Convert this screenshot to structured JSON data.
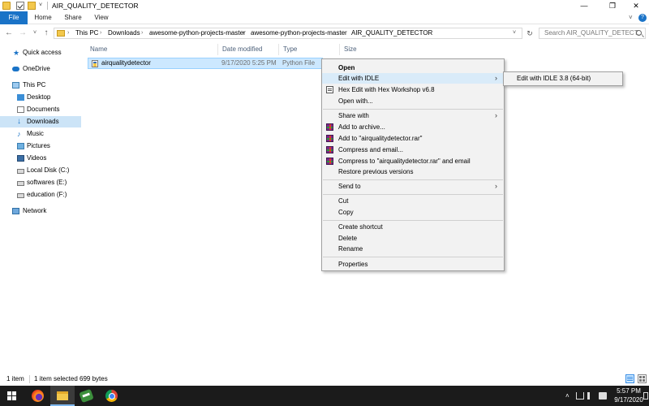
{
  "window": {
    "title": "AIR_QUALITY_DETECTOR",
    "minimize": "—",
    "maximize": "❐",
    "close": "✕"
  },
  "ribbon": {
    "tabs": [
      "File",
      "Home",
      "Share",
      "View"
    ],
    "expand": "˅",
    "help": "?"
  },
  "nav": {
    "back": "←",
    "forward": "→",
    "recent": "˅",
    "up": "↑"
  },
  "address": {
    "breadcrumbs": [
      "This PC",
      "Downloads",
      "awesome-python-projects-master",
      "awesome-python-projects-master",
      "AIR_QUALITY_DETECTOR"
    ],
    "separator": "›",
    "dropdown": "˅",
    "refresh": "↻"
  },
  "search": {
    "placeholder": "Search AIR_QUALITY_DETECT..."
  },
  "sidebar": {
    "items": [
      {
        "label": "Quick access",
        "icon": "star-icon"
      },
      {
        "label": "OneDrive",
        "icon": "cloud-icon"
      },
      {
        "label": "This PC",
        "icon": "computer-icon"
      },
      {
        "label": "Desktop",
        "icon": "desktop-icon"
      },
      {
        "label": "Documents",
        "icon": "documents-icon"
      },
      {
        "label": "Downloads",
        "icon": "downloads-icon",
        "selected": true
      },
      {
        "label": "Music",
        "icon": "music-icon"
      },
      {
        "label": "Pictures",
        "icon": "pictures-icon"
      },
      {
        "label": "Videos",
        "icon": "videos-icon"
      },
      {
        "label": "Local Disk (C:)",
        "icon": "drive-icon"
      },
      {
        "label": "softwares (E:)",
        "icon": "drive-icon"
      },
      {
        "label": "education (F:)",
        "icon": "drive-icon"
      },
      {
        "label": "Network",
        "icon": "network-icon"
      }
    ]
  },
  "columns": {
    "name": "Name",
    "date": "Date modified",
    "type": "Type",
    "size": "Size"
  },
  "files": [
    {
      "name": "airqualitydetector",
      "date": "9/17/2020 5:25 PM",
      "type": "Python File",
      "size": ""
    }
  ],
  "context_menu": {
    "open": "Open",
    "edit_idle": "Edit with IDLE",
    "hex_edit": "Hex Edit with Hex Workshop v6.8",
    "open_with": "Open with...",
    "share_with": "Share with",
    "add_archive": "Add to archive...",
    "add_rar": "Add to \"airqualitydetector.rar\"",
    "compress_email": "Compress and email...",
    "compress_rar_email": "Compress to \"airqualitydetector.rar\" and email",
    "restore": "Restore previous versions",
    "send_to": "Send to",
    "cut": "Cut",
    "copy": "Copy",
    "create_shortcut": "Create shortcut",
    "delete": "Delete",
    "rename": "Rename",
    "properties": "Properties",
    "arrow": "›"
  },
  "submenu": {
    "edit_idle_38": "Edit with IDLE 3.8 (64-bit)"
  },
  "status": {
    "count": "1 item",
    "selected": "1 item selected  699 bytes"
  },
  "taskbar": {
    "tray_chevron": "˄",
    "time": "5:57 PM",
    "date": "9/17/2020"
  },
  "colors": {
    "accent": "#1a73c7",
    "selection": "#cce8ff",
    "menu_bg": "#f2f2f2",
    "taskbar": "#1b1b1b"
  }
}
